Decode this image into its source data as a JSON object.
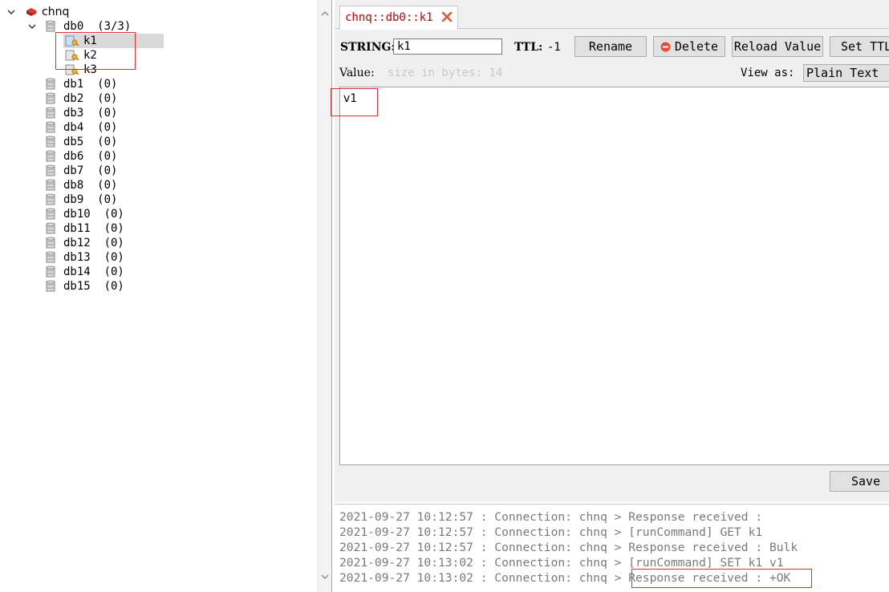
{
  "tree": {
    "server": {
      "name": "chnq"
    },
    "db0": {
      "label": "db0  (3/3)"
    },
    "keys": [
      "k1",
      "k2",
      "k3"
    ],
    "dbs": [
      "db1  (0)",
      "db2  (0)",
      "db3  (0)",
      "db4  (0)",
      "db5  (0)",
      "db6  (0)",
      "db7  (0)",
      "db8  (0)",
      "db9  (0)",
      "db10  (0)",
      "db11  (0)",
      "db12  (0)",
      "db13  (0)",
      "db14  (0)",
      "db15  (0)"
    ]
  },
  "tab": {
    "title": "chnq::db0::k1"
  },
  "editor": {
    "type_label": "STRING:",
    "key_name": "k1",
    "ttl_label": "TTL:",
    "ttl_value": "-1",
    "rename_label": "Rename",
    "delete_label": "Delete",
    "reload_label": "Reload Value",
    "set_ttl_label": "Set TTL",
    "value_label": "Value:",
    "value_size_hint": "size in bytes: 14",
    "view_as_label": "View as:",
    "view_as_selected": "Plain Text",
    "value": "v1",
    "save_label": "Save"
  },
  "log": [
    "2021-09-27 10:12:57 : Connection: chnq > Response received :",
    "2021-09-27 10:12:57 : Connection: chnq > [runCommand] GET k1",
    "2021-09-27 10:12:57 : Connection: chnq > Response received : Bulk",
    "2021-09-27 10:13:02 : Connection: chnq > [runCommand] SET k1 v1",
    "2021-09-27 10:13:02 : Connection: chnq > Response received : +OK"
  ]
}
